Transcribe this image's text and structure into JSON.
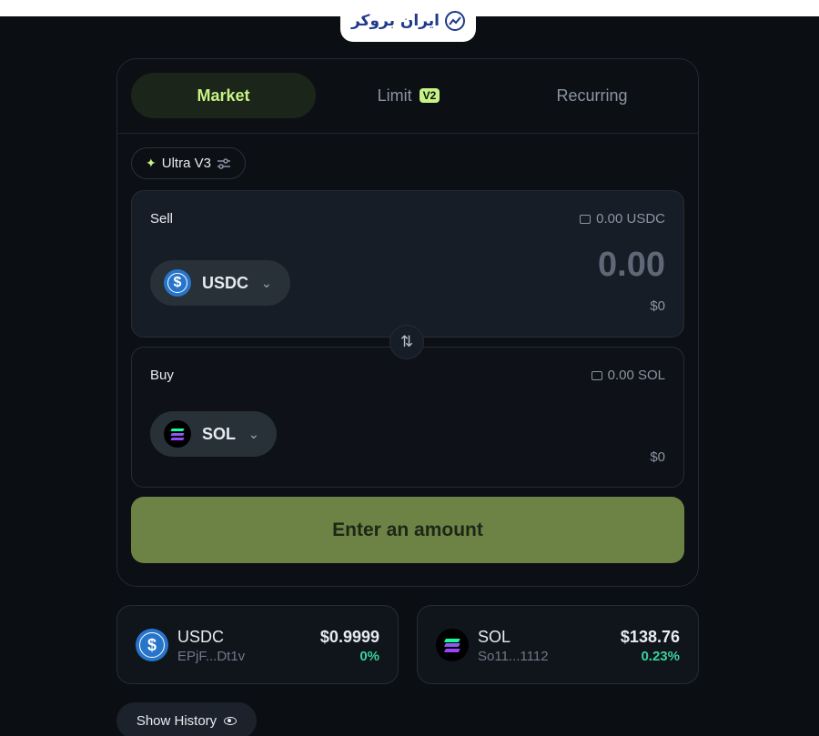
{
  "brand": {
    "logo_text": "ایران بروکر"
  },
  "tabs": [
    {
      "label": "Market",
      "active": true
    },
    {
      "label": "Limit",
      "badge": "V2"
    },
    {
      "label": "Recurring"
    }
  ],
  "ultra": {
    "label": "Ultra V3"
  },
  "sell": {
    "label": "Sell",
    "balance": "0.00 USDC",
    "token": "USDC",
    "amount": "0.00",
    "usd": "$0"
  },
  "buy": {
    "label": "Buy",
    "balance": "0.00 SOL",
    "token": "SOL",
    "usd": "$0"
  },
  "swap_icon": "⇅",
  "cta": {
    "label": "Enter an amount"
  },
  "tokens": [
    {
      "symbol": "USDC",
      "address": "EPjF...Dt1v",
      "price": "$0.9999",
      "change": "0%"
    },
    {
      "symbol": "SOL",
      "address": "So11...1112",
      "price": "$138.76",
      "change": "0.23%"
    }
  ],
  "history": {
    "label": "Show History"
  },
  "colors": {
    "accent": "#c7f284",
    "cta_bg": "#6d8346",
    "positive": "#38d19b",
    "usdc_blue": "#2775ca"
  }
}
